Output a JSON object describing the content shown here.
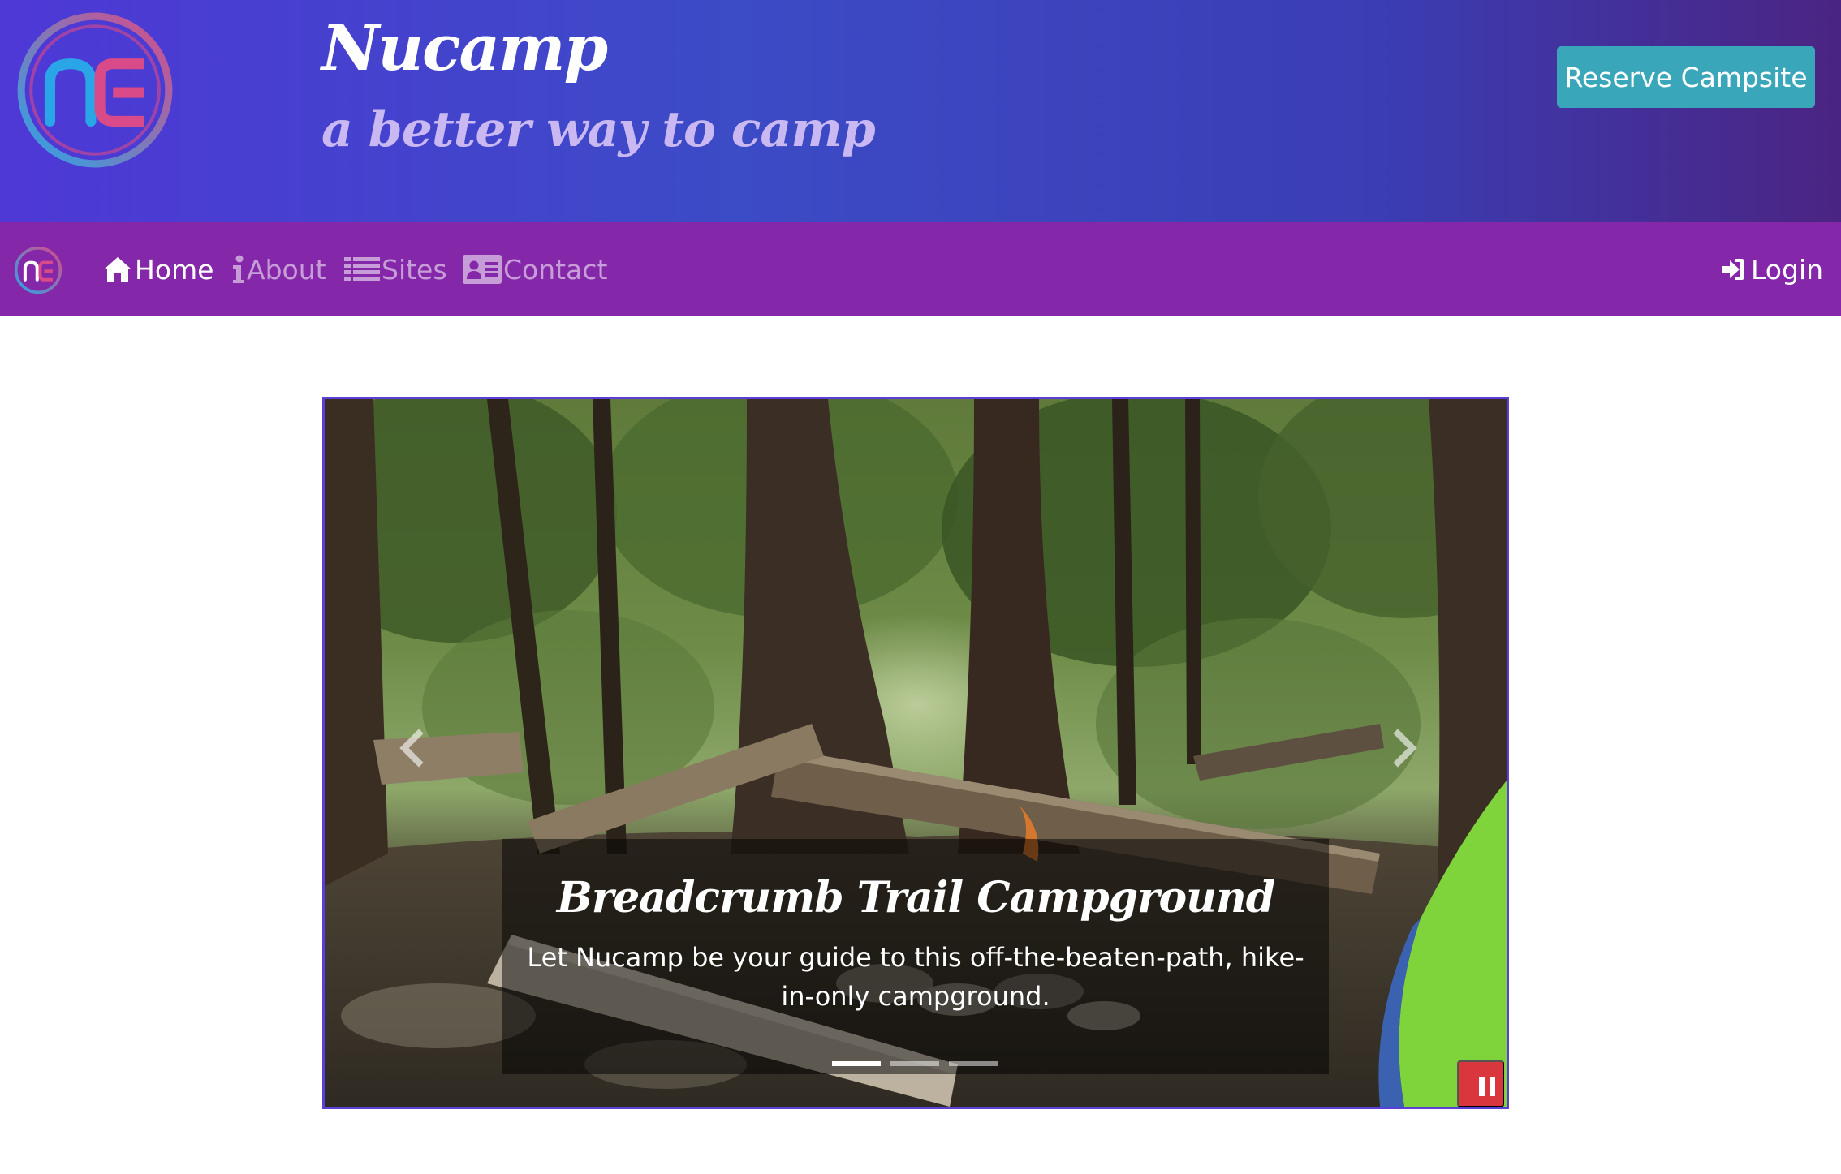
{
  "header": {
    "title": "Nucamp",
    "tagline": "a better way to camp",
    "reserve_button": "Reserve Campsite",
    "logo_icon": "nucamp-logo"
  },
  "navbar": {
    "items": [
      {
        "label": "Home",
        "icon": "home-icon",
        "active": true
      },
      {
        "label": "About",
        "icon": "info-icon",
        "active": false
      },
      {
        "label": "Sites",
        "icon": "list-icon",
        "active": false
      },
      {
        "label": "Contact",
        "icon": "address-card-icon",
        "active": false
      }
    ],
    "login": {
      "label": "Login",
      "icon": "sign-in-icon"
    }
  },
  "carousel": {
    "slide": {
      "title": "Breadcrumb Trail Campground",
      "text": "Let Nucamp be your guide to this off-the-beaten-path, hike-in-only campground."
    },
    "indicator_count": 3,
    "active_indicator": 0,
    "prev_icon": "chevron-left-icon",
    "next_icon": "chevron-right-icon",
    "pause_icon": "pause-icon"
  },
  "colors": {
    "header_gradient_start": "#4e38d6",
    "header_gradient_end": "#4b2482",
    "navbar": "#8427a9",
    "reserve_button": "#3aa6b9",
    "pause_button": "#d9363e",
    "carousel_border": "#5b3fd6",
    "tagline": "#c9b8f2"
  }
}
